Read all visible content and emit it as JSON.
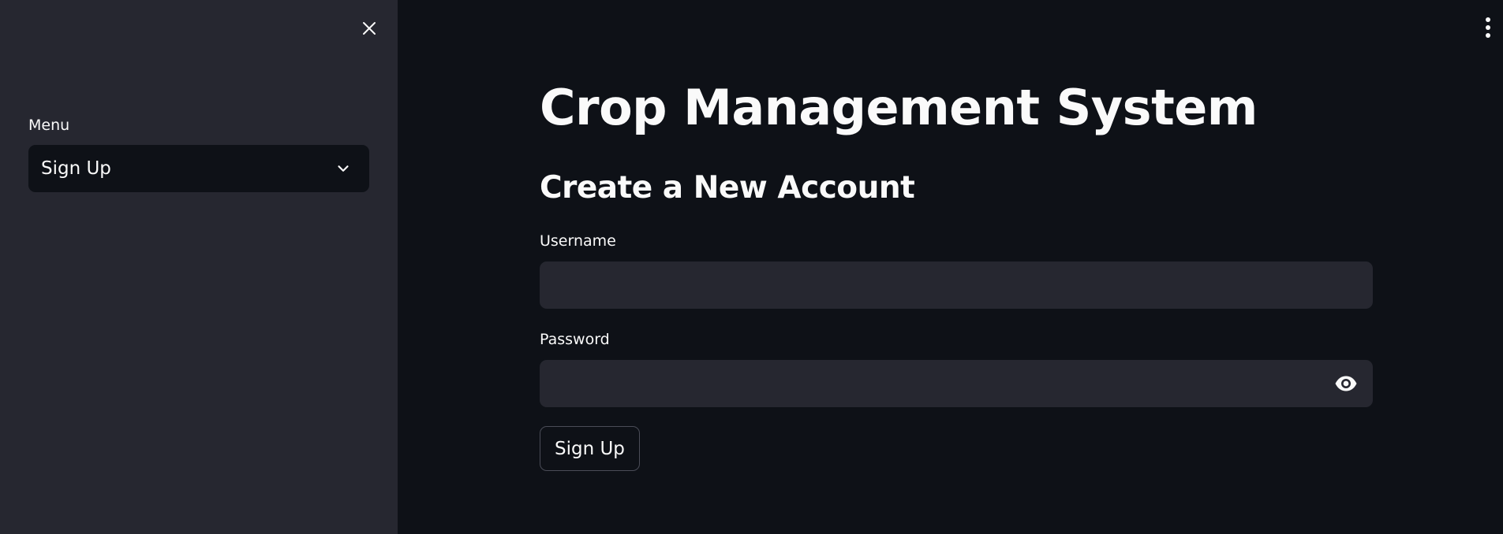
{
  "sidebar": {
    "menu_label": "Menu",
    "menu_selected": "Sign Up",
    "close_icon": "close-icon",
    "chevron_icon": "chevron-down-icon"
  },
  "header": {
    "more_icon": "more-vertical-icon"
  },
  "main": {
    "title": "Crop Management System",
    "section_title": "Create a New Account",
    "username_label": "Username",
    "username_value": "",
    "password_label": "Password",
    "password_value": "",
    "eye_icon": "eye-icon",
    "signup_label": "Sign Up"
  },
  "colors": {
    "background": "#0e1117",
    "sidebar": "#262730",
    "input": "#262730",
    "text": "#fafafa"
  }
}
